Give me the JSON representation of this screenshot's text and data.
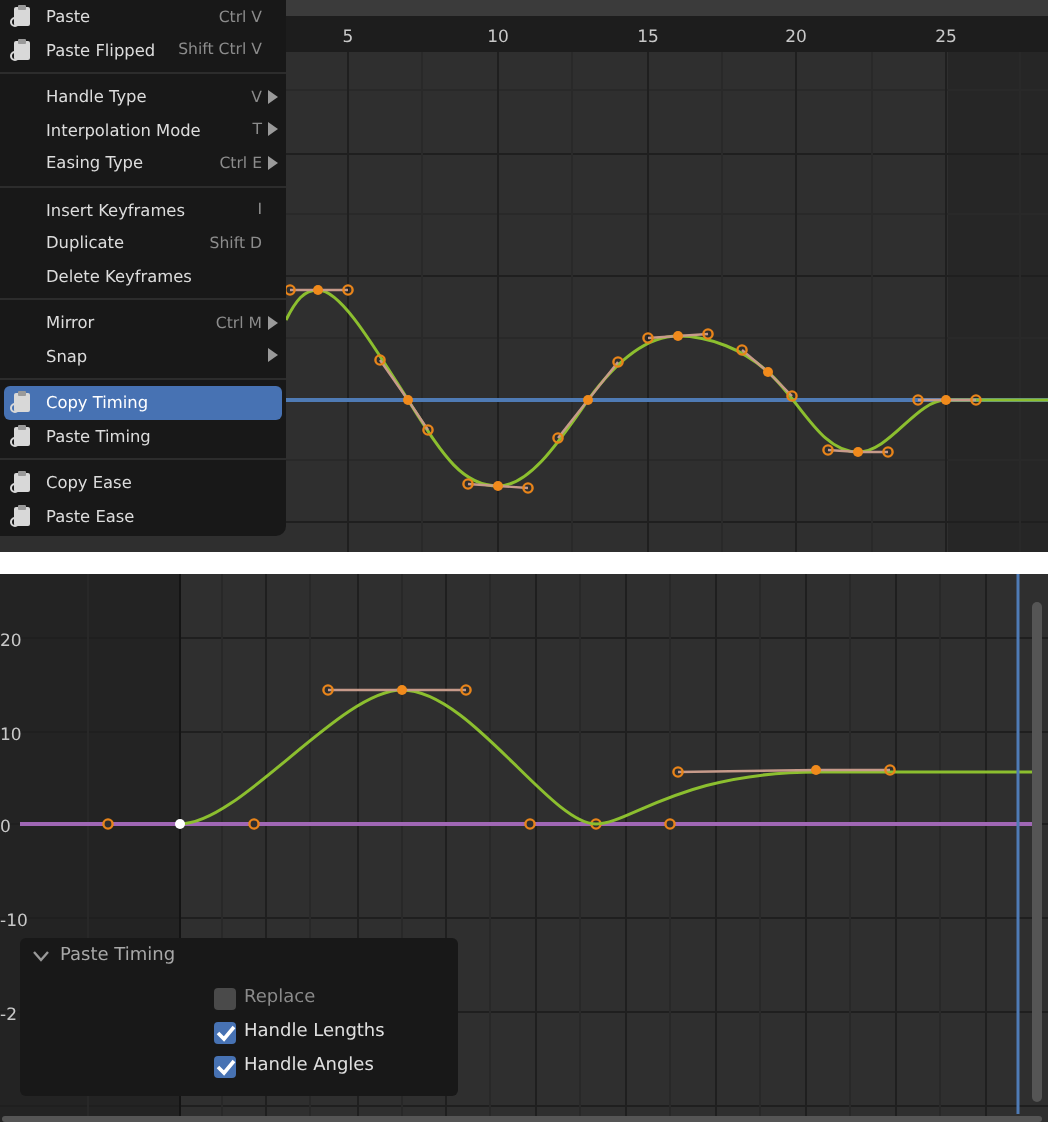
{
  "top_editor": {
    "ruler_labels": [
      "5",
      "10",
      "15",
      "20",
      "25"
    ]
  },
  "context_menu": {
    "items": [
      {
        "kind": "item",
        "has_icon": true,
        "label": "Paste",
        "shortcut": "Ctrl V",
        "submenu": false,
        "selected": false
      },
      {
        "kind": "item",
        "has_icon": true,
        "label": "Paste Flipped",
        "shortcut": "Shift Ctrl V",
        "submenu": false,
        "selected": false
      },
      {
        "kind": "separator"
      },
      {
        "kind": "item",
        "has_icon": false,
        "label": "Handle Type",
        "shortcut": "V",
        "submenu": true,
        "selected": false
      },
      {
        "kind": "item",
        "has_icon": false,
        "label": "Interpolation Mode",
        "shortcut": "T",
        "submenu": true,
        "selected": false
      },
      {
        "kind": "item",
        "has_icon": false,
        "label": "Easing Type",
        "shortcut": "Ctrl E",
        "submenu": true,
        "selected": false
      },
      {
        "kind": "separator"
      },
      {
        "kind": "item",
        "has_icon": false,
        "label": "Insert Keyframes",
        "shortcut": "I",
        "submenu": false,
        "selected": false
      },
      {
        "kind": "item",
        "has_icon": false,
        "label": "Duplicate",
        "shortcut": "Shift D",
        "submenu": false,
        "selected": false
      },
      {
        "kind": "item",
        "has_icon": false,
        "label": "Delete Keyframes",
        "submenu": false,
        "selected": false
      },
      {
        "kind": "separator"
      },
      {
        "kind": "item",
        "has_icon": false,
        "label": "Mirror",
        "shortcut": "Ctrl M",
        "submenu": true,
        "selected": false
      },
      {
        "kind": "item",
        "has_icon": false,
        "label": "Snap",
        "submenu": true,
        "selected": false
      },
      {
        "kind": "separator"
      },
      {
        "kind": "item",
        "has_icon": true,
        "label": "Copy Timing",
        "submenu": false,
        "selected": true
      },
      {
        "kind": "item",
        "has_icon": true,
        "label": "Paste Timing",
        "submenu": false,
        "selected": false
      },
      {
        "kind": "separator"
      },
      {
        "kind": "item",
        "has_icon": true,
        "label": "Copy Ease",
        "submenu": false,
        "selected": false
      },
      {
        "kind": "item",
        "has_icon": true,
        "label": "Paste Ease",
        "submenu": false,
        "selected": false
      }
    ]
  },
  "bottom_editor": {
    "axis_labels": [
      "20",
      "10",
      "0",
      "-10",
      "-2"
    ]
  },
  "redo_panel": {
    "title": "Paste Timing",
    "expanded": true,
    "options": [
      {
        "label": "Replace",
        "checked": false,
        "disabled": true
      },
      {
        "label": "Handle Lengths",
        "checked": true,
        "disabled": false
      },
      {
        "label": "Handle Angles",
        "checked": true,
        "disabled": false
      }
    ]
  }
}
